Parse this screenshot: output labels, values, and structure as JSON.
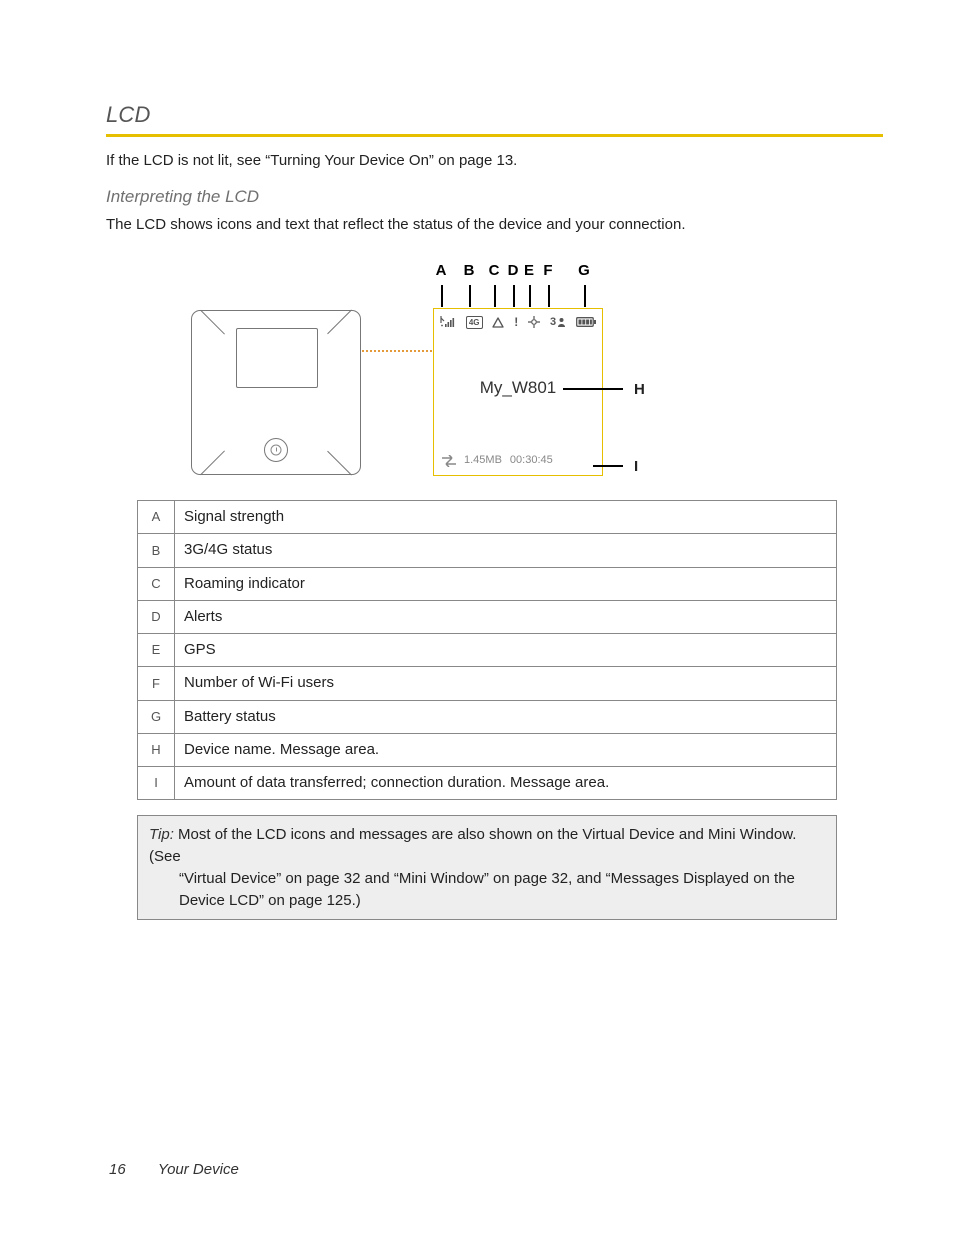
{
  "heading": "LCD",
  "intro": "If the LCD is not lit, see “Turning Your Device On” on page 13.",
  "subheading": "Interpreting the LCD",
  "sub_intro": "The LCD shows icons and text that reflect the status of the device and your connection.",
  "diagram": {
    "callouts_top": [
      "A",
      "B",
      "C",
      "D",
      "E",
      "F",
      "G"
    ],
    "callout_h": "H",
    "callout_i": "I",
    "lcd_name": "My_W801",
    "lcd_data": "1.45MB",
    "lcd_time": "00:30:45",
    "lcd_4g": "4G",
    "lcd_users": "3"
  },
  "legend": [
    {
      "key": "A",
      "desc": "Signal strength"
    },
    {
      "key": "B",
      "desc": "3G/4G status"
    },
    {
      "key": "C",
      "desc": "Roaming indicator"
    },
    {
      "key": "D",
      "desc": "Alerts"
    },
    {
      "key": "E",
      "desc": "GPS"
    },
    {
      "key": "F",
      "desc": "Number of Wi-Fi users"
    },
    {
      "key": "G",
      "desc": "Battery status"
    },
    {
      "key": "H",
      "desc": "Device name. Message area."
    },
    {
      "key": "I",
      "desc": "Amount of data transferred; connection duration. Message area."
    }
  ],
  "tip": {
    "label": "Tip:",
    "text_line1": "Most of the LCD icons and messages are also shown on the Virtual Device and Mini Window. (See",
    "text_line2": "“Virtual Device” on page 32 and “Mini Window” on page 32, and “Messages Displayed on the",
    "text_line3": "Device LCD” on page 125.)"
  },
  "footer": {
    "page": "16",
    "section": "Your Device"
  }
}
